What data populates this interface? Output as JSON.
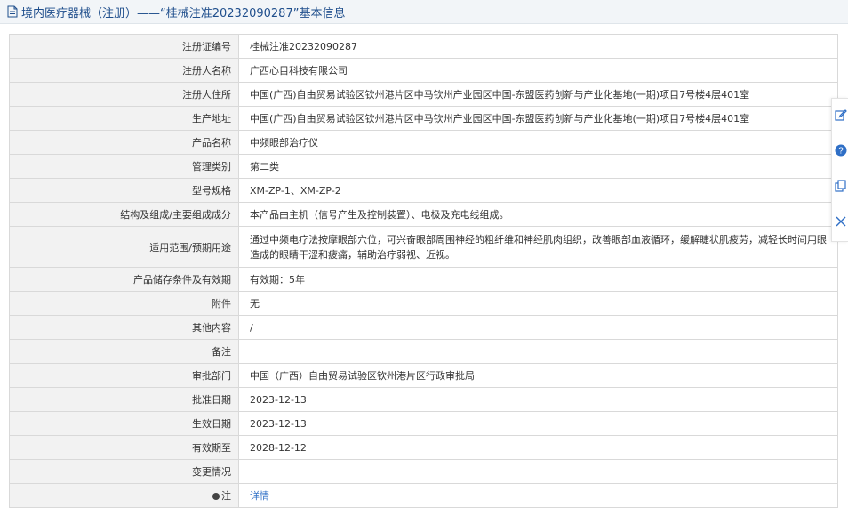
{
  "header": {
    "title": "境内医疗器械（注册）——“桂械注准20232090287”基本信息"
  },
  "rows": [
    {
      "label": "注册证编号",
      "value": "桂械注准20232090287"
    },
    {
      "label": "注册人名称",
      "value": "广西心目科技有限公司"
    },
    {
      "label": "注册人住所",
      "value": "中国(广西)自由贸易试验区钦州港片区中马钦州产业园区中国-东盟医药创新与产业化基地(一期)项目7号楼4层401室"
    },
    {
      "label": "生产地址",
      "value": "中国(广西)自由贸易试验区钦州港片区中马钦州产业园区中国-东盟医药创新与产业化基地(一期)项目7号楼4层401室"
    },
    {
      "label": "产品名称",
      "value": "中频眼部治疗仪"
    },
    {
      "label": "管理类别",
      "value": "第二类"
    },
    {
      "label": "型号规格",
      "value": "XM-ZP-1、XM-ZP-2"
    },
    {
      "label": "结构及组成/主要组成成分",
      "value": "本产品由主机（信号产生及控制装置）、电极及充电线组成。"
    },
    {
      "label": "适用范围/预期用途",
      "value": "通过中频电疗法按摩眼部穴位，可兴奋眼部周围神经的粗纤维和神经肌肉组织，改善眼部血液循环，缓解睫状肌疲劳，减轻长时间用眼造成的眼睛干涩和疲痛，辅助治疗弱视、近视。"
    },
    {
      "label": "产品储存条件及有效期",
      "value": "有效期：5年"
    },
    {
      "label": "附件",
      "value": "无"
    },
    {
      "label": "其他内容",
      "value": "/"
    },
    {
      "label": "备注",
      "value": ""
    },
    {
      "label": "审批部门",
      "value": "中国（广西）自由贸易试验区钦州港片区行政审批局"
    },
    {
      "label": "批准日期",
      "value": "2023-12-13"
    },
    {
      "label": "生效日期",
      "value": "2023-12-13"
    },
    {
      "label": "有效期至",
      "value": "2028-12-12"
    },
    {
      "label": "变更情况",
      "value": ""
    },
    {
      "label": "注",
      "value": "详情"
    }
  ],
  "side_panel": {
    "icons": [
      "edit-icon",
      "help-icon",
      "copy-icon",
      "close-icon"
    ]
  }
}
